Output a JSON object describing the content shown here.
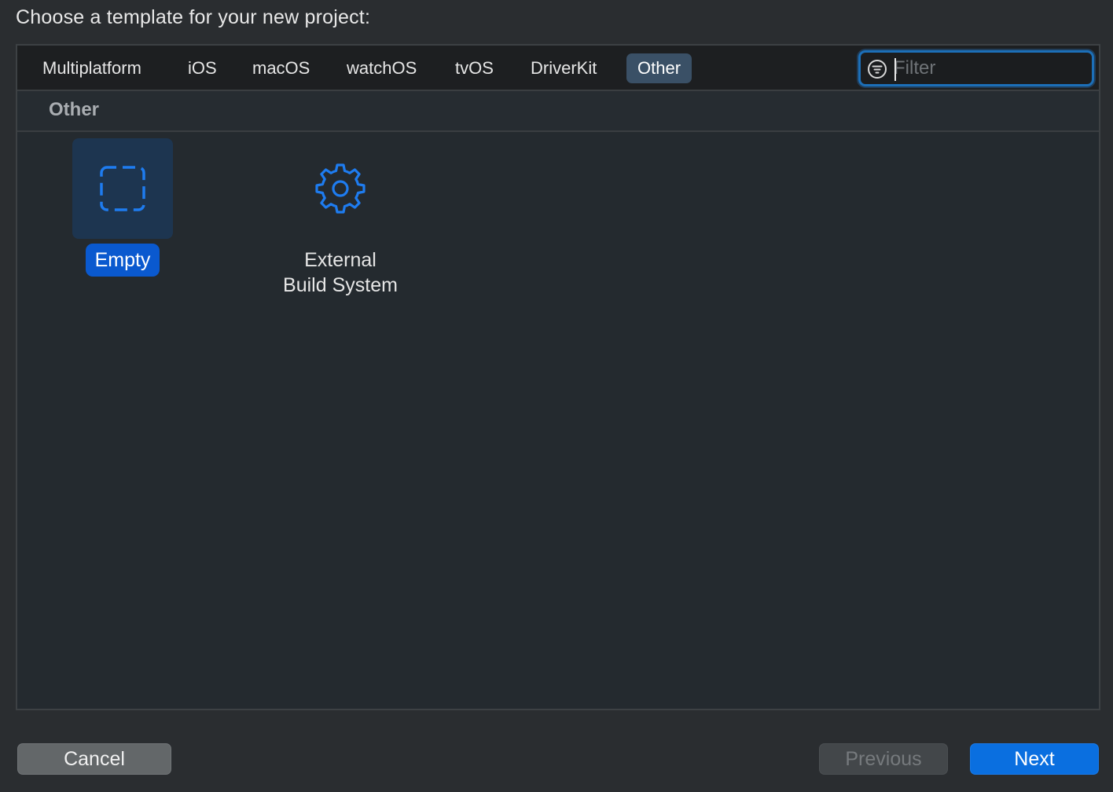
{
  "prompt": "Choose a template for your new project:",
  "tabs": [
    {
      "label": "Multiplatform"
    },
    {
      "label": "iOS"
    },
    {
      "label": "macOS"
    },
    {
      "label": "watchOS"
    },
    {
      "label": "tvOS"
    },
    {
      "label": "DriverKit"
    },
    {
      "label": "Other",
      "active": true
    }
  ],
  "filter": {
    "placeholder": "Filter",
    "value": "",
    "icon": "filter-icon"
  },
  "section": {
    "title": "Other"
  },
  "templates": [
    {
      "label": "Empty",
      "icon": "dashed-square-icon",
      "selected": true
    },
    {
      "label": "External\nBuild System",
      "icon": "gear-icon",
      "selected": false
    }
  ],
  "buttons": {
    "cancel": "Cancel",
    "previous": "Previous",
    "next": "Next"
  },
  "colors": {
    "accent": "#0a6fe0",
    "selection": "#0a59cf",
    "icon": "#1e7cf0"
  }
}
